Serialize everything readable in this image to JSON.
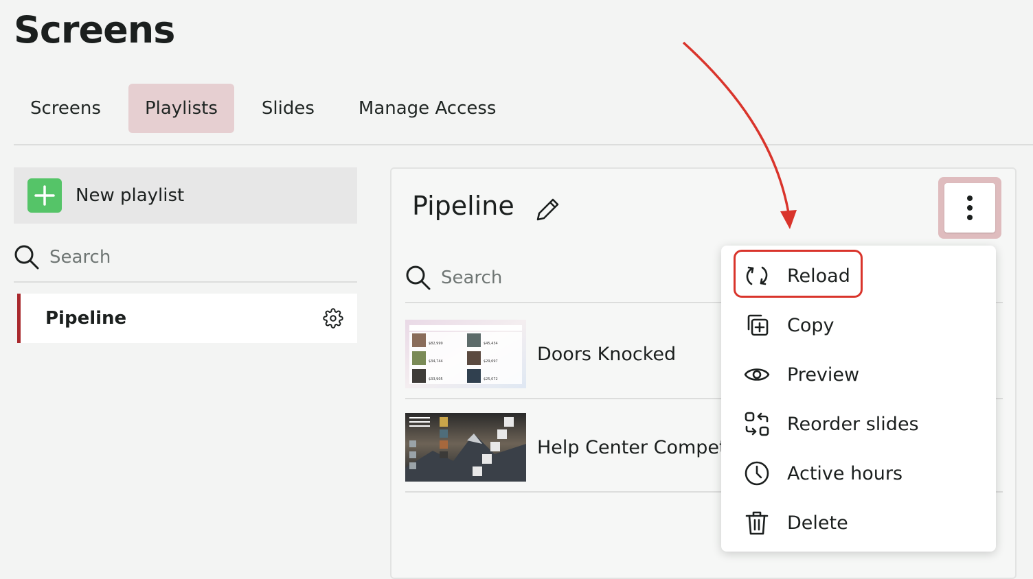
{
  "page": {
    "title": "Screens"
  },
  "tabs": [
    {
      "label": "Screens",
      "active": false
    },
    {
      "label": "Playlists",
      "active": true
    },
    {
      "label": "Slides",
      "active": false
    },
    {
      "label": "Manage Access",
      "active": false
    }
  ],
  "sidebar": {
    "new_playlist_label": "New playlist",
    "search_placeholder": "Search",
    "items": [
      {
        "label": "Pipeline",
        "selected": true
      }
    ]
  },
  "playlist": {
    "title": "Pipeline",
    "search_placeholder": "Search",
    "slides": [
      {
        "label": "Doors Knocked",
        "thumb_values": [
          "$82,999",
          "$45,434",
          "$34,744",
          "$29,697",
          "$33,905",
          "$25,072"
        ]
      },
      {
        "label": "Help Center Competition"
      }
    ]
  },
  "menu": {
    "items": [
      {
        "label": "Reload",
        "icon": "reload-icon",
        "highlighted": true
      },
      {
        "label": "Copy",
        "icon": "copy-icon"
      },
      {
        "label": "Preview",
        "icon": "eye-icon"
      },
      {
        "label": "Reorder slides",
        "icon": "reorder-icon"
      },
      {
        "label": "Active hours",
        "icon": "clock-icon"
      },
      {
        "label": "Delete",
        "icon": "trash-icon"
      }
    ]
  },
  "colors": {
    "accent": "#a8282c",
    "active_tab_bg": "#e6cfd1",
    "new_button_green": "#55c468",
    "annotation_red": "#d9342b"
  }
}
